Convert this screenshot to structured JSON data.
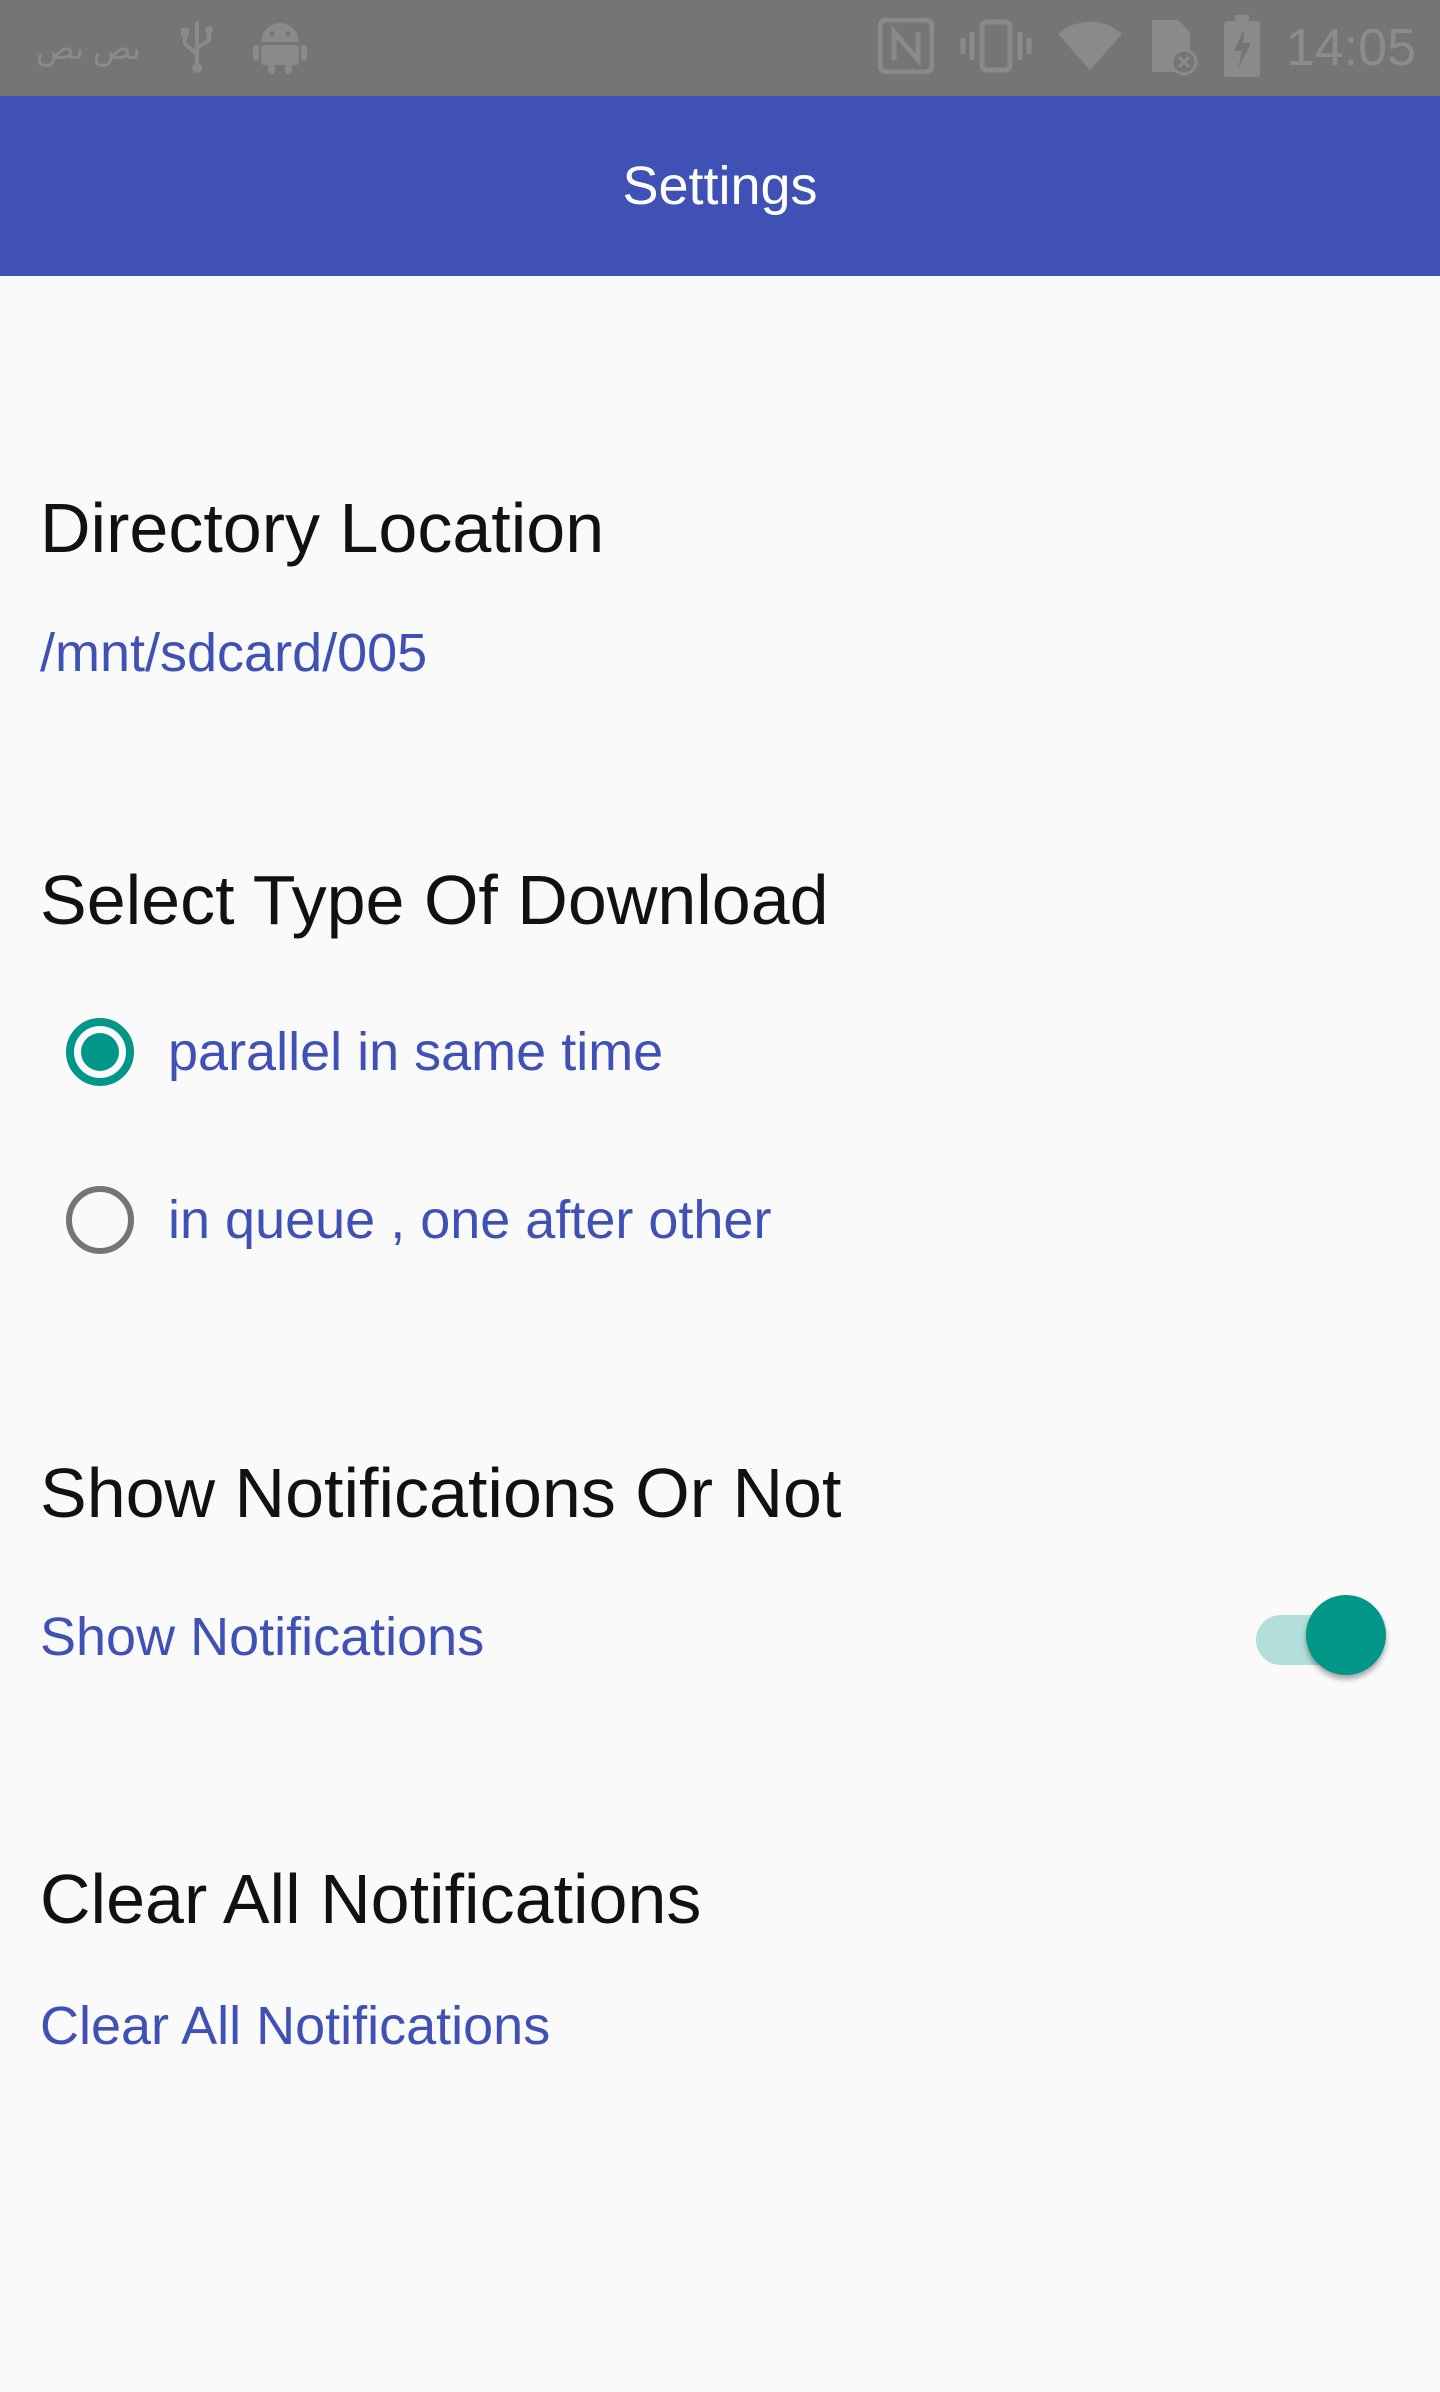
{
  "status_bar": {
    "left_text": "ىص ىص",
    "time": "14:05",
    "icons": [
      "usb-icon",
      "android-icon",
      "nfc-icon",
      "vibrate-icon",
      "wifi-icon",
      "sim-icon",
      "battery-charging-icon"
    ]
  },
  "app_bar": {
    "title": "Settings",
    "color": "#3f51b5"
  },
  "sections": {
    "directory": {
      "title": "Directory Location",
      "value": "/mnt/sdcard/005"
    },
    "download_type": {
      "title": "Select Type Of Download",
      "options": [
        {
          "label": "parallel in same time",
          "selected": true
        },
        {
          "label": "in queue , one after other",
          "selected": false
        }
      ]
    },
    "notifications": {
      "title": "Show Notifications Or Not",
      "toggle_label": "Show Notifications",
      "toggle_on": true
    },
    "clear": {
      "title": "Clear All Notifications",
      "action_label": "Clear All Notifications"
    }
  },
  "colors": {
    "primary": "#3f51b5",
    "accent": "#009688"
  }
}
